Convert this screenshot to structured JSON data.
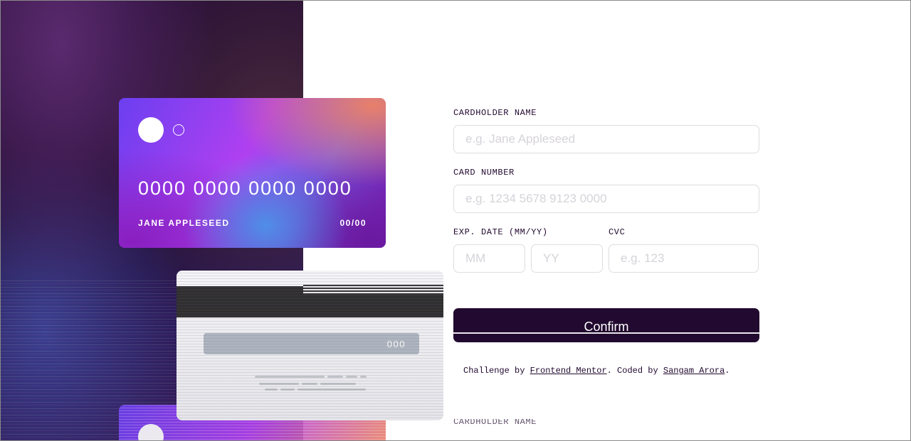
{
  "card_front": {
    "number": "0000 0000 0000 0000",
    "name": "JANE APPLESEED",
    "expiry": "00/00"
  },
  "card_back": {
    "cvc": "000"
  },
  "form": {
    "name_label": "CARDHOLDER NAME",
    "name_placeholder": "e.g. Jane Appleseed",
    "number_label": "CARD NUMBER",
    "number_placeholder": "e.g. 1234 5678 9123 0000",
    "exp_label": "EXP. DATE (MM/YY)",
    "mm_placeholder": "MM",
    "yy_placeholder": "YY",
    "cvc_label": "CVC",
    "cvc_placeholder": "e.g. 123",
    "confirm_label": "Confirm"
  },
  "attribution": {
    "prefix": "Challenge by ",
    "link1": "Frontend Mentor",
    "middle": ". Coded by ",
    "link2": "Sangam Arora",
    "suffix": "."
  },
  "ghost_label": "CARDHOLDER NAME",
  "colors": {
    "primary": "#21092f",
    "input_border": "#dedddf",
    "placeholder": "#d6d3d9",
    "card_gradient_start": "#6b3ff0",
    "card_gradient_end": "#e8806a"
  }
}
